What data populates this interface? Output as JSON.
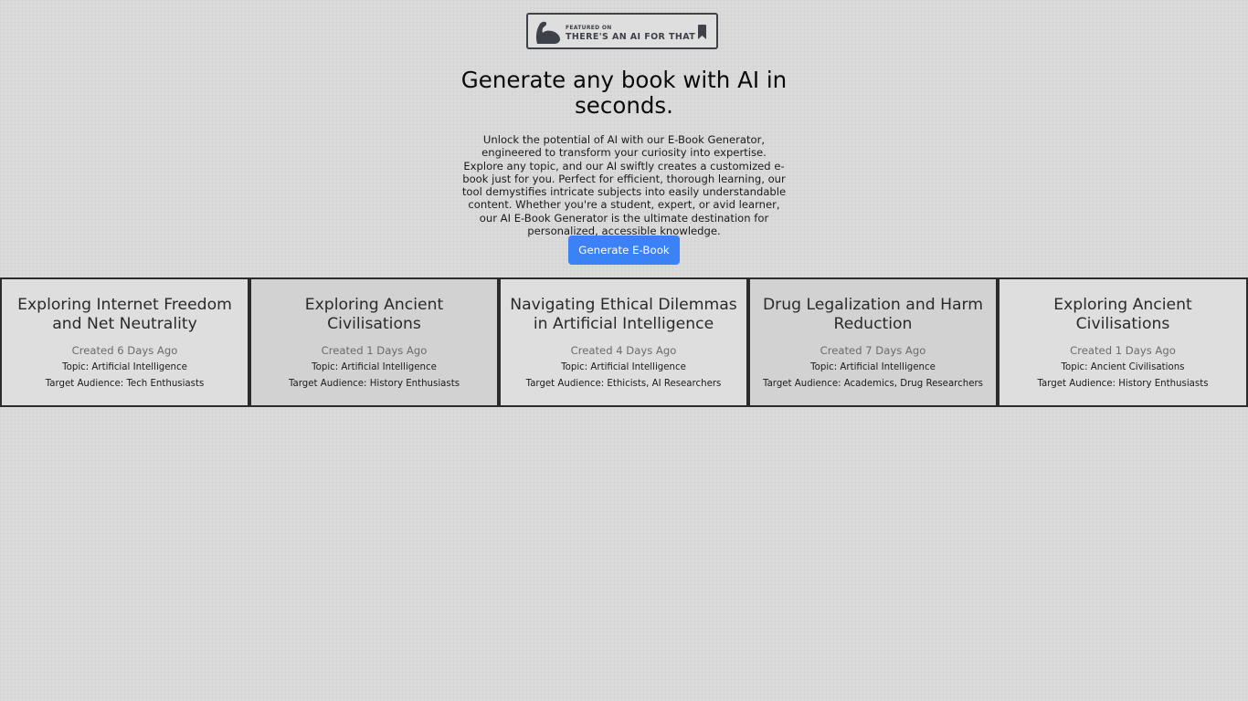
{
  "badge": {
    "featured_label": "FEATURED ON",
    "name": "THERE'S AN AI FOR THAT",
    "icon": "flexed-arm-icon",
    "bookmark_icon": "bookmark-icon",
    "color": "#3e4248"
  },
  "hero": {
    "title": "Generate any book with AI in seconds.",
    "description": "Unlock the potential of AI with our E-Book Generator, engineered to transform your curiosity into expertise. Explore any topic, and our AI swiftly creates a customized e-book just for you. Perfect for efficient, thorough learning, our tool demystifies intricate subjects into easily understandable content. Whether you're a student, expert, or avid learner, our AI E-Book Generator is the ultimate destination for personalized, accessible knowledge.",
    "cta_label": "Generate E-Book",
    "cta_color": "#3b82f6"
  },
  "cards": [
    {
      "title": "Exploring Internet Freedom and Net Neutrality",
      "created": "Created 6 Days Ago",
      "topic": "Topic: Artificial Intelligence",
      "audience": "Target Audience: Tech Enthusiasts"
    },
    {
      "title": "Exploring Ancient Civilisations",
      "created": "Created 1 Days Ago",
      "topic": "Topic: Artificial Intelligence",
      "audience": "Target Audience: History Enthusiasts"
    },
    {
      "title": "Navigating Ethical Dilemmas in Artificial Intelligence",
      "created": "Created 4 Days Ago",
      "topic": "Topic: Artificial Intelligence",
      "audience": "Target Audience: Ethicists, AI Researchers"
    },
    {
      "title": "Drug Legalization and Harm Reduction",
      "created": "Created 7 Days Ago",
      "topic": "Topic: Artificial Intelligence",
      "audience": "Target Audience: Academics, Drug Researchers"
    },
    {
      "title": "Exploring Ancient Civilisations",
      "created": "Created 1 Days Ago",
      "topic": "Topic: Ancient Civilisations",
      "audience": "Target Audience: History Enthusiasts"
    }
  ]
}
